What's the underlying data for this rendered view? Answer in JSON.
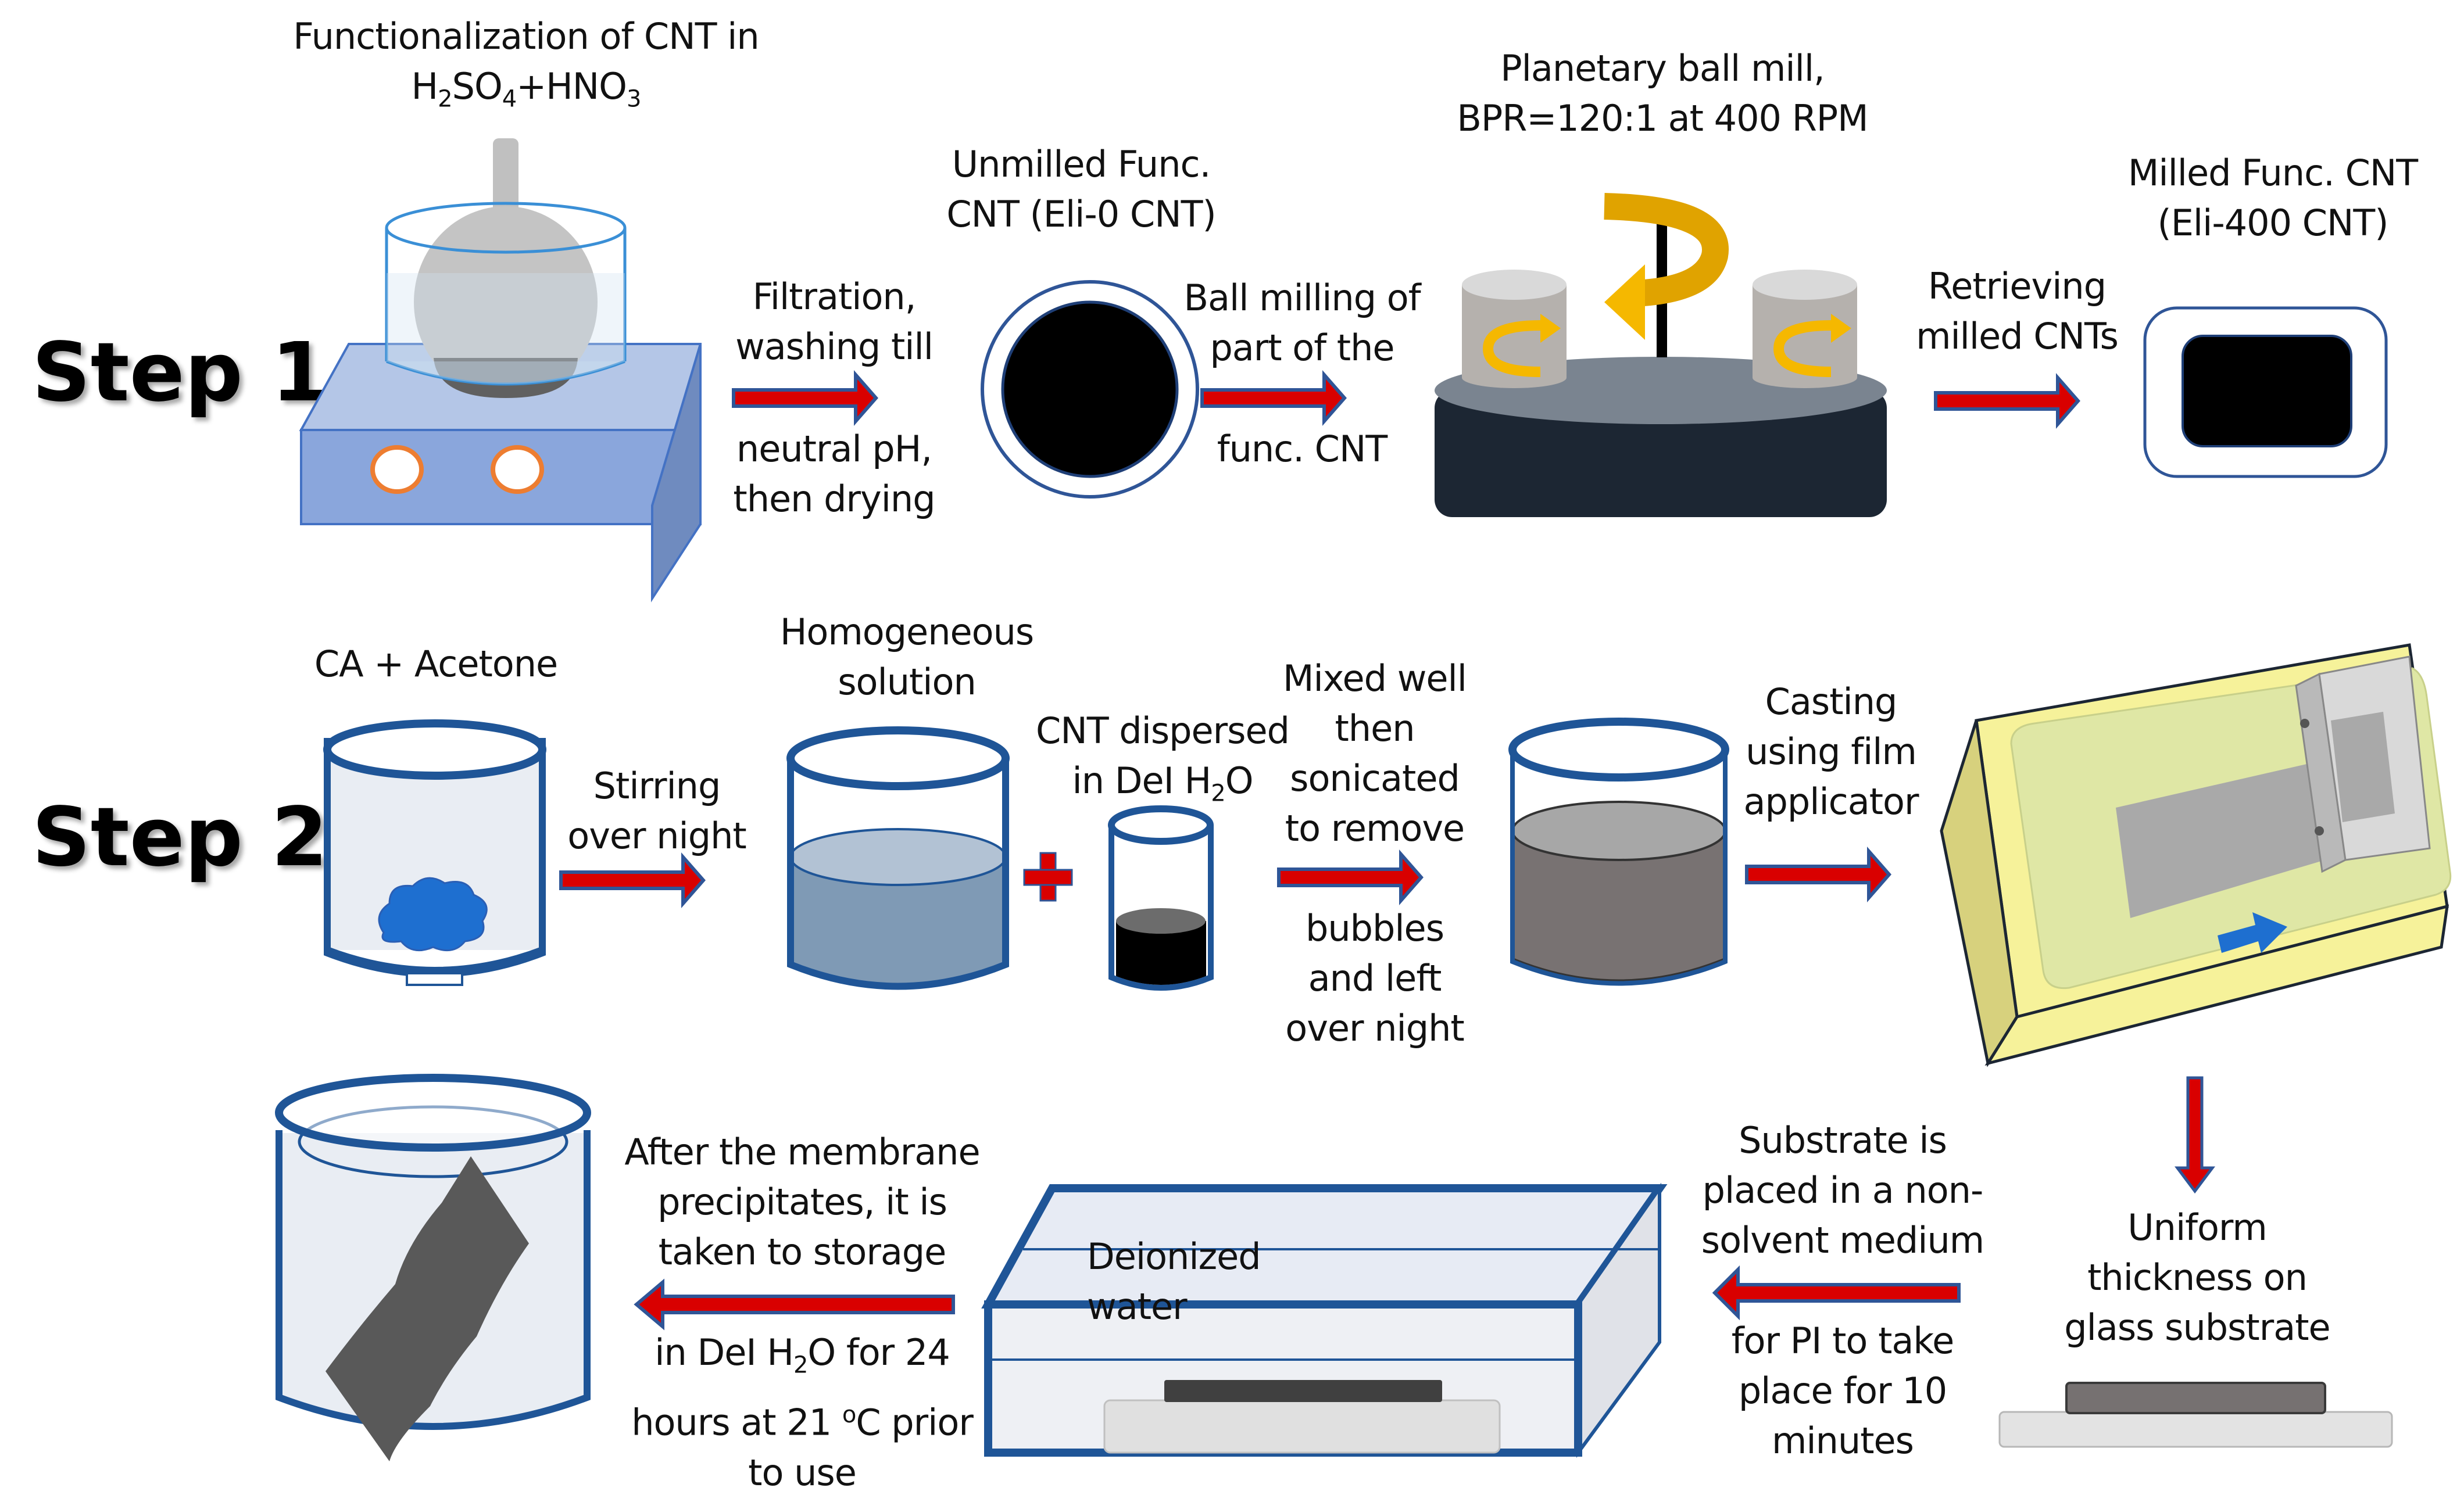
{
  "steps": {
    "step1": "Step 1",
    "step2": "Step 2"
  },
  "step1": {
    "functionalization_label": "Functionalization of CNT in",
    "acid_label_parts": [
      "H",
      "2",
      "SO",
      "4",
      "+HNO",
      "3"
    ],
    "filtration_above": [
      "Filtration,",
      "washing till"
    ],
    "filtration_below": [
      "neutral pH,",
      "then drying"
    ],
    "unmilled_label": [
      "Unmilled Func.",
      "CNT (Eli-0 CNT)"
    ],
    "ball_milling_above": [
      "Ball milling of",
      "part of the"
    ],
    "ball_milling_below": [
      "func. CNT"
    ],
    "ball_mill_label": [
      "Planetary ball mill,",
      "BPR=120:1 at 400 RPM"
    ],
    "retrieving_label": [
      "Retrieving",
      "milled CNTs"
    ],
    "milled_label": [
      "Milled Func. CNT",
      "(Eli-400 CNT)"
    ]
  },
  "step2": {
    "ca_acetone_label": "CA + Acetone",
    "stirring_label": [
      "Stirring",
      "over night"
    ],
    "homogeneous_label": [
      "Homogeneous",
      "solution"
    ],
    "cnt_dispersed_label": [
      "CNT dispersed",
      "in DeI H",
      "2",
      "O"
    ],
    "mixed_above": [
      "Mixed well",
      "then",
      "sonicated",
      "to remove"
    ],
    "mixed_below": [
      "bubbles",
      "and left",
      "over night"
    ],
    "casting_label": [
      "Casting",
      "using film",
      "applicator"
    ],
    "uniform_label": [
      "Uniform",
      "thickness on",
      "glass substrate"
    ],
    "substrate_above": [
      "Substrate is",
      "placed in a non-",
      "solvent medium"
    ],
    "substrate_below": [
      "for PI to take",
      "place for 10",
      "minutes"
    ],
    "deionized_label": "Deionized water",
    "storage_above": [
      "After the membrane",
      "precipitates, it is",
      "taken to storage"
    ],
    "storage_below_line1": [
      "in DeI H",
      "2",
      "O for 24"
    ],
    "storage_below_line2": [
      "hours at 21 ",
      "o",
      "C prior"
    ],
    "storage_below_line3": "to use"
  },
  "colors": {
    "arrow_fill": "#d90000",
    "arrow_outline": "#2f5597",
    "beaker_outline": "#1f5597",
    "hotplate": "#7f9fd8",
    "ball_mill_base": "#1c2633",
    "rotation_arrow": "#f5b800",
    "casting_plate": "#f6f29a"
  }
}
